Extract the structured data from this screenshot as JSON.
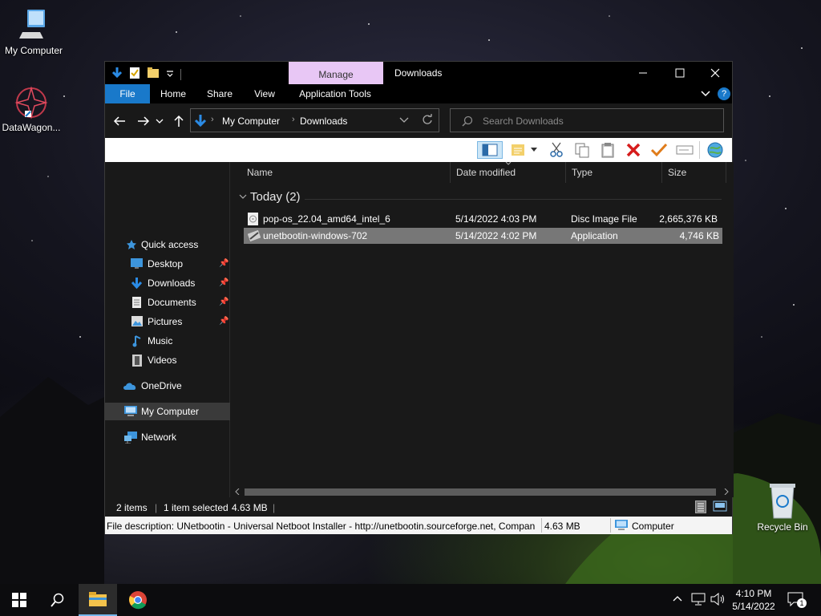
{
  "desktop": {
    "icons": [
      {
        "label": "My Computer"
      },
      {
        "label": "DataWagon..."
      },
      {
        "label": "Recycle Bin"
      }
    ]
  },
  "window": {
    "title": "Downloads",
    "manage_tab": "Manage",
    "ribbon_tabs": [
      "File",
      "Home",
      "Share",
      "View",
      "Application Tools"
    ],
    "breadcrumb": [
      "My Computer",
      "Downloads"
    ],
    "search": {
      "placeholder": "Search Downloads"
    }
  },
  "nav": {
    "quick_access": "Quick access",
    "items": [
      {
        "label": "Desktop",
        "pinned": true
      },
      {
        "label": "Downloads",
        "pinned": true
      },
      {
        "label": "Documents",
        "pinned": true
      },
      {
        "label": "Pictures",
        "pinned": true
      },
      {
        "label": "Music",
        "pinned": false
      },
      {
        "label": "Videos",
        "pinned": false
      }
    ],
    "onedrive": "OneDrive",
    "my_computer": "My Computer",
    "network": "Network"
  },
  "files": {
    "columns": [
      "Name",
      "Date modified",
      "Type",
      "Size"
    ],
    "group": "Today (2)",
    "rows": [
      {
        "name": "pop-os_22.04_amd64_intel_6",
        "date": "5/14/2022 4:03 PM",
        "type": "Disc Image File",
        "size": "2,665,376 KB",
        "selected": false
      },
      {
        "name": "unetbootin-windows-702",
        "date": "5/14/2022 4:02 PM",
        "type": "Application",
        "size": "4,746 KB",
        "selected": true
      }
    ]
  },
  "status": {
    "items": "2 items",
    "selected": "1 item selected",
    "size": "4.63 MB",
    "sep": "|"
  },
  "desc": {
    "text": "File description: UNetbootin - Universal Netboot Installer - http://unetbootin.sourceforge.net, Compan",
    "size": "4.63 MB",
    "location": "Computer"
  },
  "taskbar": {
    "time": "4:10 PM",
    "date": "5/14/2022",
    "notifications": "1"
  },
  "colors": {
    "accent": "#1979ca",
    "manage_tab": "#e8c7f5",
    "selection": "#777777"
  }
}
